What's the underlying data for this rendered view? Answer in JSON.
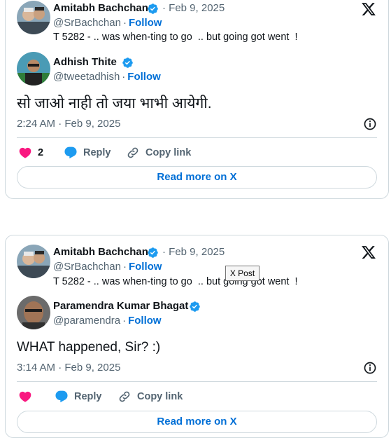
{
  "tweet1": {
    "quoted": {
      "name": "Amitabh Bachchan",
      "date": "· Feb 9, 2025",
      "handle": "@SrBachchan",
      "follow": "Follow",
      "text": "T 5282 - .. was when-ting to go  .. but going got went  !"
    },
    "reply": {
      "name": "Adhish Thite",
      "handle": "@tweetadhish",
      "follow": "Follow",
      "text": "सो जाओ नाही तो जया भाभी आयेगी.",
      "timestamp": "2:24 AM · Feb 9, 2025"
    },
    "actions": {
      "like_count": "2",
      "reply_label": "Reply",
      "copy_label": "Copy link"
    },
    "read_more": "Read more on X"
  },
  "tweet2": {
    "quoted": {
      "name": "Amitabh Bachchan",
      "date": "· Feb 9, 2025",
      "handle": "@SrBachchan",
      "follow": "Follow",
      "text": "T 5282 - .. was when-ting to go  .. but going got went  !"
    },
    "reply": {
      "name": "Paramendra Kumar Bhagat",
      "handle": "@paramendra",
      "follow": "Follow",
      "text": "WHAT happened, Sir? :)",
      "timestamp": "3:14 AM · Feb 9, 2025"
    },
    "actions": {
      "reply_label": "Reply",
      "copy_label": "Copy link"
    },
    "read_more": "Read more on X"
  },
  "tooltip": "X Post",
  "colors": {
    "like": "#f91880",
    "reply": "#1d9bf0",
    "link": "#006fd6",
    "muted": "#536471",
    "border": "#cfd9de"
  }
}
